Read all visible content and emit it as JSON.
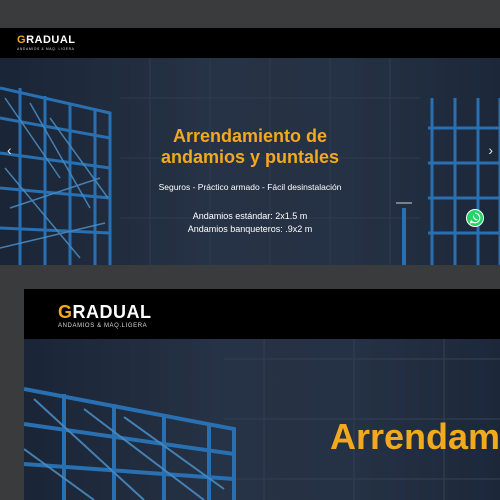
{
  "brand": {
    "name": "GRADUAL",
    "tagline_small": "ANDAMIOS & MAQ. LIGERA",
    "tagline_large": "ANDAMIOS & MAQ.LIGERA",
    "accent_color": "#f2a91e"
  },
  "hero": {
    "title_line1": "Arrendamiento de",
    "title_line2": "andamios y puntales",
    "subtitle": "Seguros - Práctico armado - Fácil desinstalación",
    "spec1": "Andamios estándar: 2x1.5 m",
    "spec2": "Andamios banqueteros: .9x2 m",
    "prev_arrow": "‹",
    "next_arrow": "›",
    "background": "blue-scaffolding-photo"
  },
  "hero_zoom": {
    "title_fragment": "Arrendam"
  },
  "whatsapp": {
    "icon": "whatsapp-icon",
    "color": "#25d366"
  }
}
